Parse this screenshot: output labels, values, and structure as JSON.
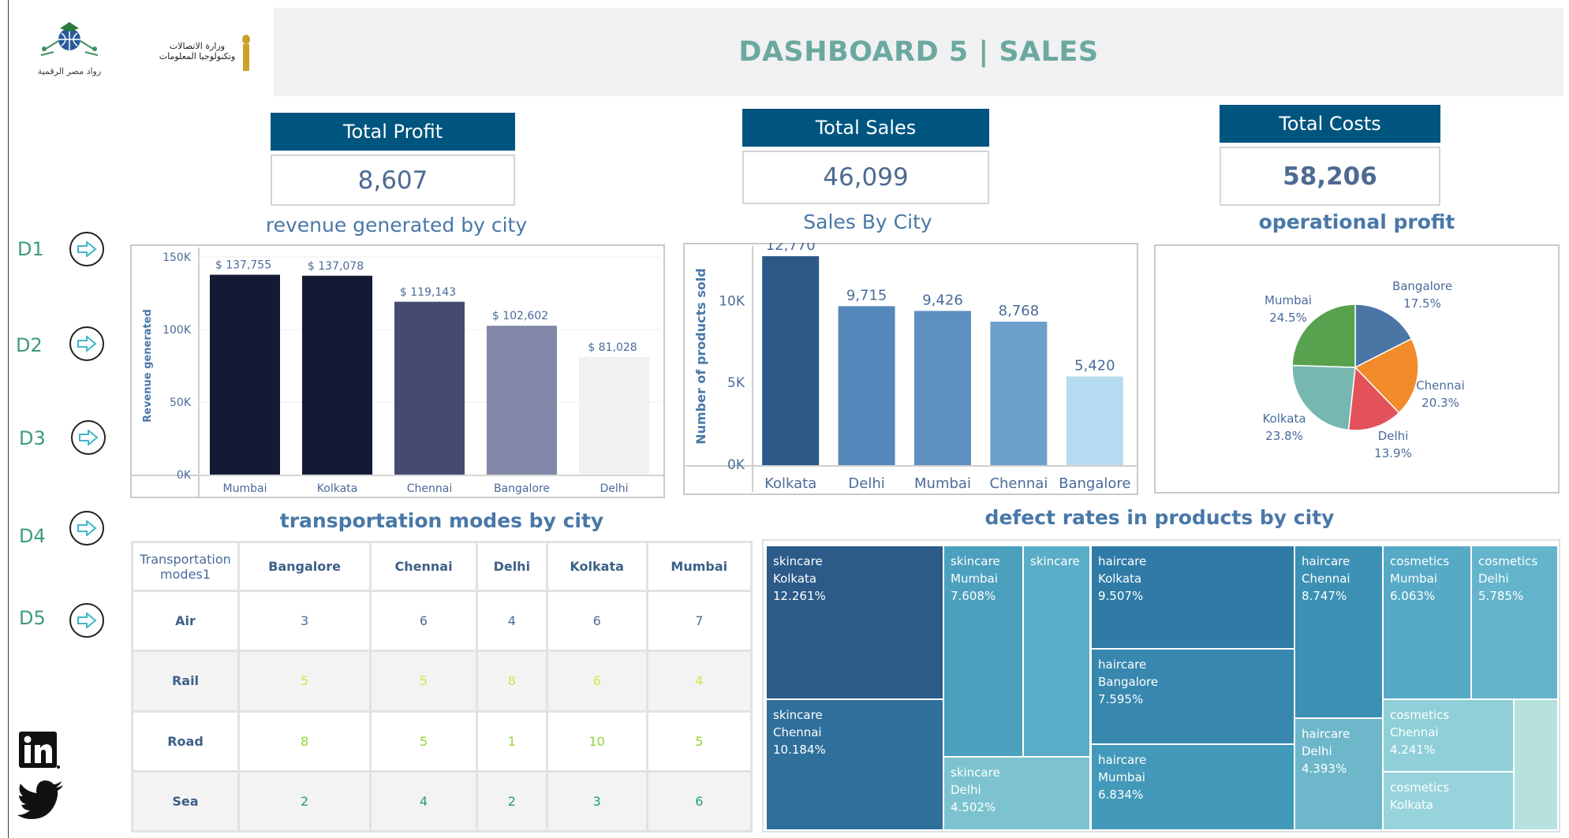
{
  "header": {
    "title": "DASHBOARD 5 | SALES",
    "logo_left_caption": "رواد مصر الرقمية",
    "logo_right_caption": "وزارة الاتصالات وتكنولوجيا المعلومات"
  },
  "kpis": [
    {
      "label": "Total Profit",
      "value": "8,607"
    },
    {
      "label": "Total Sales",
      "value": "46,099"
    },
    {
      "label": "Total Costs",
      "value": "58,206"
    }
  ],
  "nav": {
    "items": [
      "D1",
      "D2",
      "D3",
      "D4",
      "D5"
    ]
  },
  "sections": {
    "revenue": "revenue generated by city",
    "sales": "Sales By City",
    "profit": "operational profit",
    "transport": "transportation modes by city",
    "defect": "defect rates in products by city"
  },
  "colors": {
    "kpi_header": "#00557f",
    "title": "#6ba9a0",
    "nav": "#3d9c7a"
  },
  "chart_data": [
    {
      "type": "bar",
      "title": "revenue generated by city",
      "categories": [
        "Mumbai",
        "Kolkata",
        "Chennai",
        "Bangalore",
        "Delhi"
      ],
      "values": [
        137755,
        137078,
        119143,
        102602,
        81028
      ],
      "value_labels": [
        "$ 137,755",
        "$ 137,078",
        "$ 119,143",
        "$ 102,602",
        "$ 81,028"
      ],
      "colors": [
        "#141a33",
        "#141a33",
        "#454a73",
        "#8287a8",
        "#f1f1f1"
      ],
      "ylabel": "Revenue generated",
      "ylim": [
        0,
        150000
      ],
      "yticks": [
        0,
        50000,
        100000,
        150000
      ],
      "ytick_labels": [
        "0K",
        "50K",
        "100K",
        "150K"
      ]
    },
    {
      "type": "bar",
      "title": "Sales By City",
      "categories": [
        "Kolkata",
        "Delhi",
        "Mumbai",
        "Chennai",
        "Bangalore"
      ],
      "values": [
        12770,
        9715,
        9426,
        8768,
        5420
      ],
      "value_labels": [
        "12,770",
        "9,715",
        "9,426",
        "8,768",
        "5,420"
      ],
      "colors": [
        "#2b5886",
        "#5588ba",
        "#5c90c0",
        "#6d9fcb",
        "#b7dbf0"
      ],
      "ylabel": "Number of products sold",
      "ylim": [
        0,
        13300
      ],
      "yticks": [
        0,
        5000,
        10000
      ],
      "ytick_labels": [
        "0K",
        "5K",
        "10K"
      ]
    },
    {
      "type": "pie",
      "title": "operational profit",
      "slices": [
        {
          "label": "Bangalore",
          "pct": 17.5,
          "pct_label": "17.5%",
          "color": "#4a76a6"
        },
        {
          "label": "Chennai",
          "pct": 20.3,
          "pct_label": "20.3%",
          "color": "#f28c2a"
        },
        {
          "label": "Delhi",
          "pct": 13.9,
          "pct_label": "13.9%",
          "color": "#e3525a"
        },
        {
          "label": "Kolkata",
          "pct": 23.8,
          "pct_label": "23.8%",
          "color": "#77b7b2"
        },
        {
          "label": "Mumbai",
          "pct": 24.5,
          "pct_label": "24.5%",
          "color": "#58a14e"
        }
      ]
    },
    {
      "type": "table",
      "title": "transportation modes by city",
      "corner": "Transportation modes1",
      "columns": [
        "Bangalore",
        "Chennai",
        "Delhi",
        "Kolkata",
        "Mumbai"
      ],
      "rows": [
        {
          "label": "Air",
          "values": [
            "3",
            "6",
            "4",
            "6",
            "7"
          ],
          "color": "#4a6b9a"
        },
        {
          "label": "Rail",
          "values": [
            "5",
            "5",
            "8",
            "6",
            "4"
          ],
          "color": "#d4e64a"
        },
        {
          "label": "Road",
          "values": [
            "8",
            "5",
            "1",
            "10",
            "5"
          ],
          "color": "#8ed63a"
        },
        {
          "label": "Sea",
          "values": [
            "2",
            "4",
            "2",
            "3",
            "6"
          ],
          "color": "#1f9e6e"
        }
      ]
    },
    {
      "type": "treemap",
      "title": "defect rates in products by city",
      "cells": [
        {
          "category": "skincare",
          "city": "Kolkata",
          "value": "12.261%"
        },
        {
          "category": "skincare",
          "city": "Chennai",
          "value": "10.184%"
        },
        {
          "category": "skincare",
          "city": "Mumbai",
          "value": "7.608%"
        },
        {
          "category": "skincare",
          "city": "",
          "value": ""
        },
        {
          "category": "skincare",
          "city": "Delhi",
          "value": "4.502%"
        },
        {
          "category": "haircare",
          "city": "Kolkata",
          "value": "9.507%"
        },
        {
          "category": "haircare",
          "city": "Chennai",
          "value": "8.747%"
        },
        {
          "category": "haircare",
          "city": "Bangalore",
          "value": "7.595%"
        },
        {
          "category": "haircare",
          "city": "Mumbai",
          "value": "6.834%"
        },
        {
          "category": "haircare",
          "city": "Delhi",
          "value": "4.393%"
        },
        {
          "category": "cosmetics",
          "city": "Mumbai",
          "value": "6.063%"
        },
        {
          "category": "cosmetics",
          "city": "Delhi",
          "value": "5.785%"
        },
        {
          "category": "cosmetics",
          "city": "Chennai",
          "value": "4.241%"
        },
        {
          "category": "cosmetics",
          "city": "Kolkata",
          "value": ""
        },
        {
          "category": "",
          "city": "",
          "value": ""
        }
      ]
    }
  ]
}
